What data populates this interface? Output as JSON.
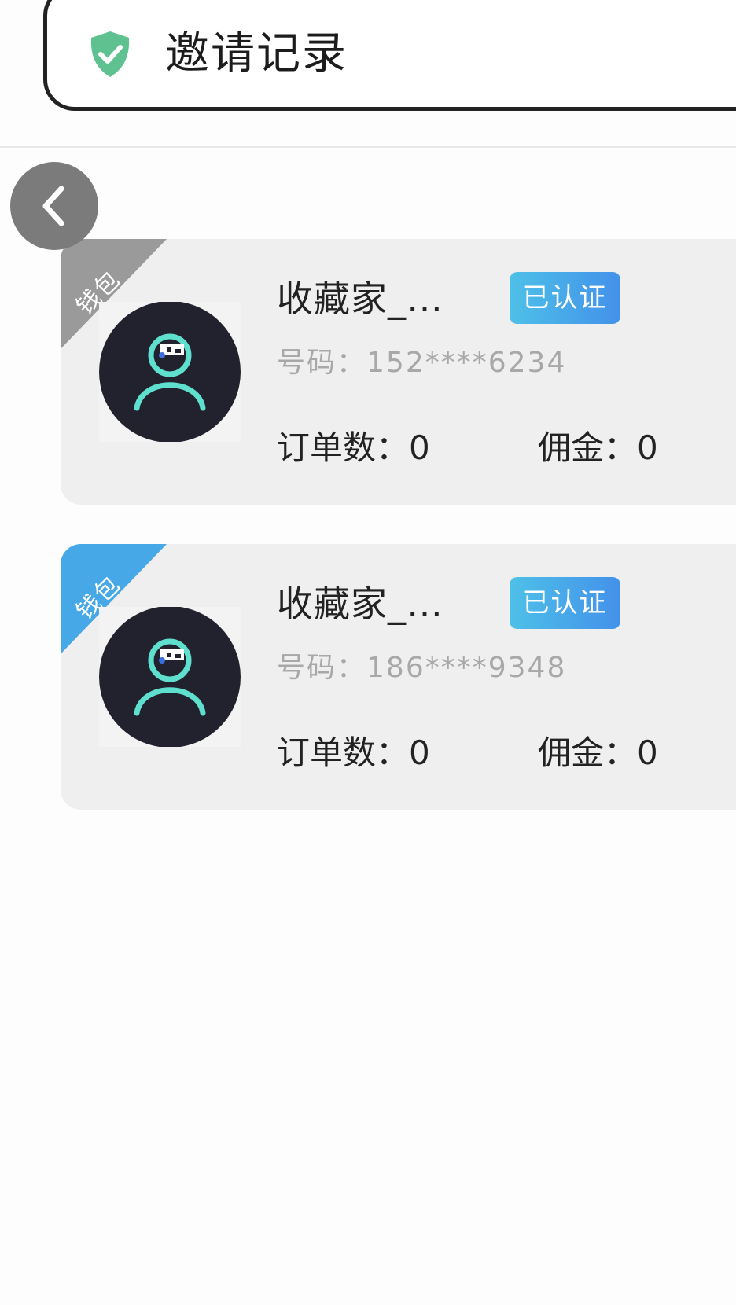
{
  "header": {
    "title": "邀请记录",
    "icon": "shield-check-icon",
    "icon_color": "#5ec18f"
  },
  "back_button": {
    "icon": "chevron-left-icon"
  },
  "records": [
    {
      "ribbon_label": "钱包",
      "ribbon_color": "#9a9a9a",
      "name": "收藏家_…",
      "badge": "已认证",
      "phone_label": "号码：",
      "phone": "152****6234",
      "orders_label": "订单数：",
      "orders": "0",
      "commission_label": "佣金：",
      "commission": "0"
    },
    {
      "ribbon_label": "钱包",
      "ribbon_color": "#46a8e6",
      "name": "收藏家_…",
      "badge": "已认证",
      "phone_label": "号码：",
      "phone": "186****9348",
      "orders_label": "订单数：",
      "orders": "0",
      "commission_label": "佣金：",
      "commission": "0"
    }
  ]
}
